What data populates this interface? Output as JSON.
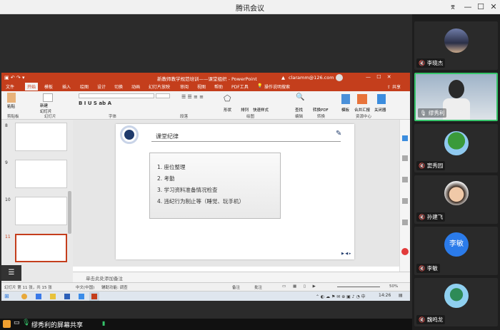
{
  "window": {
    "title": "腾讯会议"
  },
  "ppt": {
    "doc_title": "新教师教学规范培训——课堂组织 - PowerPoint",
    "account": "claramm@126.com",
    "tabs": [
      "文件",
      "开始",
      "模板",
      "插入",
      "绘图",
      "设计",
      "切换",
      "动画",
      "幻灯片放映",
      "审阅",
      "视图",
      "帮助",
      "PDF工具",
      "操作说明搜索"
    ],
    "share_label": "共享",
    "ribbon_groups": [
      "剪贴板",
      "幻灯片",
      "字体",
      "段落",
      "绘图",
      "编辑",
      "转换",
      "资源中心"
    ],
    "ribbon_buttons": {
      "paste": "粘贴",
      "new_slide": "新建\n幻灯片",
      "shape": "形状",
      "arrange": "排列",
      "quick_style": "快速样式",
      "find": "查找",
      "to_pdf": "转换PDF",
      "template": "模板",
      "quick_gif": "合并汇报",
      "close": "关闭器"
    },
    "thumb_numbers": [
      "8",
      "9",
      "10",
      "11"
    ],
    "slide": {
      "heading": "课堂纪律",
      "items": [
        "1. 座位整理",
        "2. 考勤",
        "3. 学习资料准备情况检查",
        "4. 违纪行为制止等（睡觉、玩手机）"
      ]
    },
    "notes_placeholder": "单击此处添加备注",
    "status": {
      "slide_info": "幻灯片 第 11 张，共 15 张",
      "lang": "中文(中国)",
      "accessibility": "辅助功能: 调查",
      "notes": "备注",
      "comments": "批注",
      "zoom": "50%"
    },
    "taskbar": {
      "time": "14:26"
    }
  },
  "bottom_bar": {
    "label": "缪秀利的屏幕共享"
  },
  "participants": [
    {
      "name": "李晓杰"
    },
    {
      "name": "缪秀利"
    },
    {
      "name": "窦秀园"
    },
    {
      "name": "孙建飞"
    },
    {
      "name": "李敏",
      "avatar_text": "李敏"
    },
    {
      "name": "魏鸣龙"
    }
  ],
  "colors": {
    "ppt_red": "#c43e1c",
    "avatar_blue": "#2b7bea",
    "active_border": "#35c46a"
  }
}
